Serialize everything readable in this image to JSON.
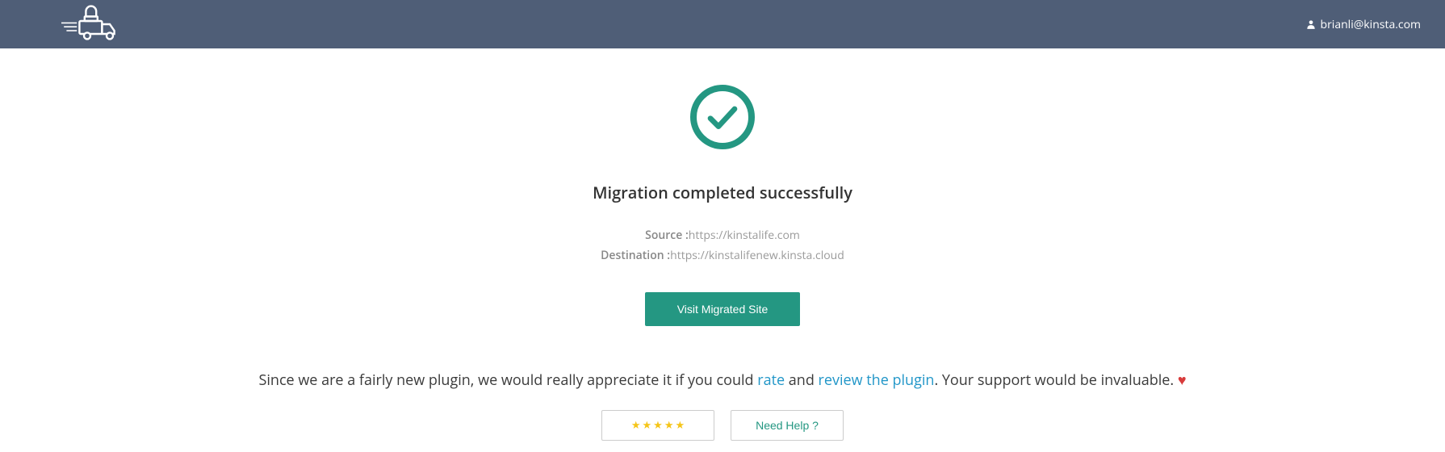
{
  "header": {
    "user_email": "brianli@kinsta.com"
  },
  "main": {
    "title": "Migration completed successfully",
    "source_label": "Source :",
    "source_value": "https://kinstalife.com",
    "destination_label": "Destination :",
    "destination_value": "https://kinstalifenew.kinsta.cloud",
    "visit_button": "Visit Migrated Site"
  },
  "footer": {
    "text_before_rate": "Since we are a fairly new plugin, we would really appreciate it if you could ",
    "rate_link": "rate",
    "text_and": " and ",
    "review_link": "review the plugin",
    "text_after": ". Your support would be invaluable. ",
    "heart": "♥",
    "need_help_label": "Need Help ?"
  }
}
